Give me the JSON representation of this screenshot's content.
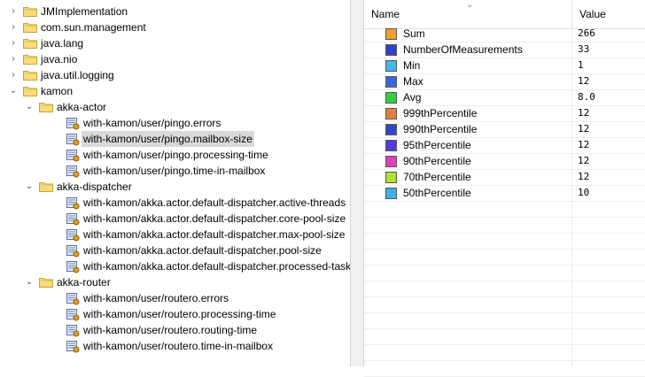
{
  "tree": {
    "items": [
      {
        "label": "JMImplementation",
        "kind": "package",
        "level": 0,
        "expanded": false
      },
      {
        "label": "com.sun.management",
        "kind": "package",
        "level": 0,
        "expanded": false
      },
      {
        "label": "java.lang",
        "kind": "package",
        "level": 0,
        "expanded": false
      },
      {
        "label": "java.nio",
        "kind": "package",
        "level": 0,
        "expanded": false
      },
      {
        "label": "java.util.logging",
        "kind": "package",
        "level": 0,
        "expanded": false
      },
      {
        "label": "kamon",
        "kind": "package",
        "level": 0,
        "expanded": true
      },
      {
        "label": "akka-actor",
        "kind": "package",
        "level": 1,
        "expanded": true
      },
      {
        "label": "with-kamon/user/pingo.errors",
        "kind": "mbean",
        "level": 2
      },
      {
        "label": "with-kamon/user/pingo.mailbox-size",
        "kind": "mbean",
        "level": 2,
        "selected": true
      },
      {
        "label": "with-kamon/user/pingo.processing-time",
        "kind": "mbean",
        "level": 2
      },
      {
        "label": "with-kamon/user/pingo.time-in-mailbox",
        "kind": "mbean",
        "level": 2
      },
      {
        "label": "akka-dispatcher",
        "kind": "package",
        "level": 1,
        "expanded": true
      },
      {
        "label": "with-kamon/akka.actor.default-dispatcher.active-threads",
        "kind": "mbean",
        "level": 2
      },
      {
        "label": "with-kamon/akka.actor.default-dispatcher.core-pool-size",
        "kind": "mbean",
        "level": 2
      },
      {
        "label": "with-kamon/akka.actor.default-dispatcher.max-pool-size",
        "kind": "mbean",
        "level": 2
      },
      {
        "label": "with-kamon/akka.actor.default-dispatcher.pool-size",
        "kind": "mbean",
        "level": 2
      },
      {
        "label": "with-kamon/akka.actor.default-dispatcher.processed-tasks",
        "kind": "mbean",
        "level": 2
      },
      {
        "label": "akka-router",
        "kind": "package",
        "level": 1,
        "expanded": true
      },
      {
        "label": "with-kamon/user/routero.errors",
        "kind": "mbean",
        "level": 2
      },
      {
        "label": "with-kamon/user/routero.processing-time",
        "kind": "mbean",
        "level": 2
      },
      {
        "label": "with-kamon/user/routero.routing-time",
        "kind": "mbean",
        "level": 2
      },
      {
        "label": "with-kamon/user/routero.time-in-mailbox",
        "kind": "mbean",
        "level": 2
      }
    ]
  },
  "table": {
    "headers": {
      "name": "Name",
      "value": "Value"
    },
    "rows": [
      {
        "name": "Sum",
        "value": "266",
        "color": "#f0a030"
      },
      {
        "name": "NumberOfMeasurements",
        "value": "33",
        "color": "#3040c8"
      },
      {
        "name": "Min",
        "value": "1",
        "color": "#40b8e8"
      },
      {
        "name": "Max",
        "value": "12",
        "color": "#3a66d8"
      },
      {
        "name": "Avg",
        "value": "8.0",
        "color": "#30d040"
      },
      {
        "name": "999thPercentile",
        "value": "12",
        "color": "#e08040"
      },
      {
        "name": "990thPercentile",
        "value": "12",
        "color": "#3048c8"
      },
      {
        "name": "95thPercentile",
        "value": "12",
        "color": "#5838e0"
      },
      {
        "name": "90thPercentile",
        "value": "12",
        "color": "#e040c0"
      },
      {
        "name": "70thPercentile",
        "value": "12",
        "color": "#b0e030"
      },
      {
        "name": "50thPercentile",
        "value": "10",
        "color": "#40b0e8"
      }
    ]
  }
}
